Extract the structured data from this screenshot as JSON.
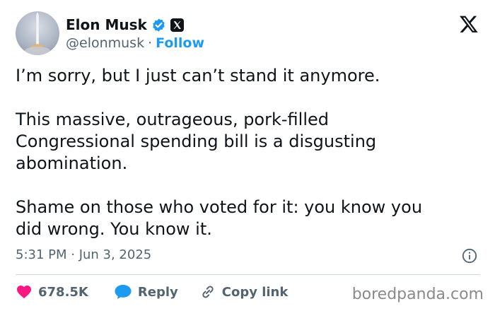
{
  "author": {
    "name": "Elon Musk",
    "handle": "@elonmusk",
    "separator": "·",
    "follow_label": "Follow"
  },
  "tweet": {
    "text": "I’m sorry, but I just can’t stand it anymore.\n\nThis massive, outrageous, pork-filled\nCongressional spending bill is a disgusting\nabomination.\n\nShame on those who voted for it: you know you\ndid wrong. You know it.",
    "timestamp": "5:31 PM · Jun 3, 2025"
  },
  "actions": {
    "likes": "678.5K",
    "reply_label": "Reply",
    "copy_link_label": "Copy link"
  },
  "watermark": "boredpanda.com",
  "colors": {
    "accent": "#1d9bf0",
    "like": "#f91880",
    "text": "#0f1419",
    "muted": "#536471"
  }
}
